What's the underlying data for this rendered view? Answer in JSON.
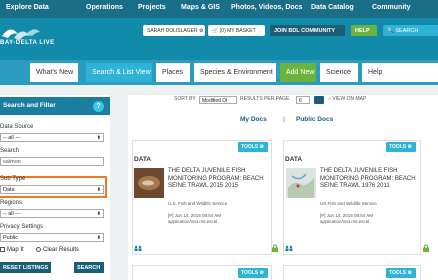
{
  "top_nav": [
    "Explore Data",
    "Operations",
    "Projects",
    "Maps & GIS",
    "Photos, Videos, Docs",
    "Data Catalog",
    "Community"
  ],
  "logo_text": "BAY-DELTA LIVE",
  "header": {
    "user": "SARAH DOLISLAGER",
    "basket": "(0) MY BASKET",
    "community": "JOIN BDL COMMUNITY",
    "help": "HELP",
    "search": "SEARCH"
  },
  "tabs": [
    {
      "label": "What's New",
      "state": "normal"
    },
    {
      "label": "Search & List View",
      "state": "active"
    },
    {
      "label": "Places",
      "state": "normal"
    },
    {
      "label": "Species & Environment",
      "state": "normal"
    },
    {
      "label": "Add New",
      "state": "green"
    },
    {
      "label": "Science",
      "state": "normal"
    },
    {
      "label": "Help",
      "state": "normal"
    }
  ],
  "sidebar": {
    "title": "Search and Filter",
    "help_icon": "?",
    "data_source_label": "Data Source",
    "data_source_value": "-- all ---",
    "search_label": "Search",
    "search_value": "salmon",
    "subtype_label": "Sub Type",
    "subtype_value": "Data",
    "regions_label": "Regions",
    "regions_value": "-- all ---",
    "privacy_label": "Privacy Settings",
    "privacy_value": "Public",
    "map_it": "Map It",
    "clear_results": "Clear Results",
    "reset_button": "RESET LISTINGS",
    "search_button": "SEARCH"
  },
  "sortbar": {
    "sort_by": "SORT BY",
    "sort_value": "Modified Dt",
    "results_per_page": "RESULTS PER PAGE",
    "results_value": "6",
    "view_on_map": "VIEW ON MAP"
  },
  "doc_tabs": {
    "my": "My Docs",
    "sep": "|",
    "public": "Public Docs"
  },
  "cards": [
    {
      "tools": "TOOLS",
      "type": "DATA",
      "title": "THE DELTA JUVENILE FISH MONITORING PROGRAM: BEACH SEINE TRAWL 2015 2015",
      "org": "U.S. Fish and Wildlife Service",
      "date": "[P] Jun 14, 2015 09:54 AM",
      "format": "application/vnd.ms-excel"
    },
    {
      "tools": "TOOLS",
      "type": "DATA",
      "title": "THE DELTA JUVENILE FISH MONITORING PROGRAM: BEACH SEINE TRAWL 1976 2011",
      "org": "US Fish and Wildlife Service",
      "date": "[P] Jun 14, 2015 09:54 AM",
      "format": "application/vnd.ms-excel"
    }
  ],
  "cards_row2": [
    {
      "tools": "TOOLS"
    },
    {
      "tools": "TOOLS"
    }
  ],
  "colors": {
    "nav": "#1a6e87",
    "header": "#128bab",
    "accent": "#2eb3d6",
    "green": "#6cb33e",
    "highlight": "#f07a21"
  }
}
